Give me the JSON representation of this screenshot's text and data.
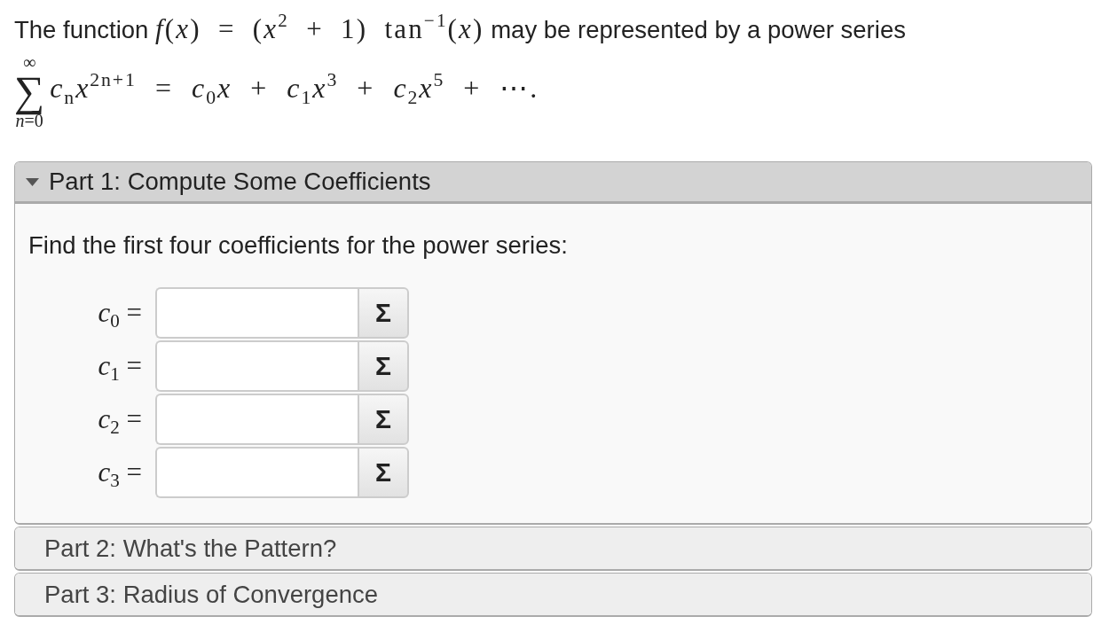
{
  "problem": {
    "statement": [
      {
        "kind": "text",
        "text": "The function "
      },
      {
        "kind": "math",
        "text": "*f*(*x*) = (*x*$^{2}$ + 1) tan$^{−1}$(*x*)"
      },
      {
        "kind": "text",
        "text": " may be represented by a power series"
      }
    ],
    "series": {
      "symbol": "∑",
      "upper": "∞",
      "lower": "*n*=0",
      "expression": "*c*$_{n}$*x*$^{2n+1}$ = *c*$_{0}$*x* + *c*$_{1}$*x*$^{3}$ + *c*$_{2}$*x*$^{5}$ + ⋯."
    }
  },
  "parts": [
    {
      "title": "Part 1: Compute Some Coefficients",
      "expanded": true,
      "prompt": "Find the first four coefficients for the power series:",
      "answers": [
        {
          "label": "*c*$_{0}$ =",
          "button": "Σ"
        },
        {
          "label": "*c*$_{1}$ =",
          "button": "Σ"
        },
        {
          "label": "*c*$_{2}$ =",
          "button": "Σ"
        },
        {
          "label": "*c*$_{3}$ =",
          "button": "Σ"
        }
      ]
    },
    {
      "title": "Part 2: What's the Pattern?",
      "expanded": false
    },
    {
      "title": "Part 3: Radius of Convergence",
      "expanded": false
    }
  ]
}
